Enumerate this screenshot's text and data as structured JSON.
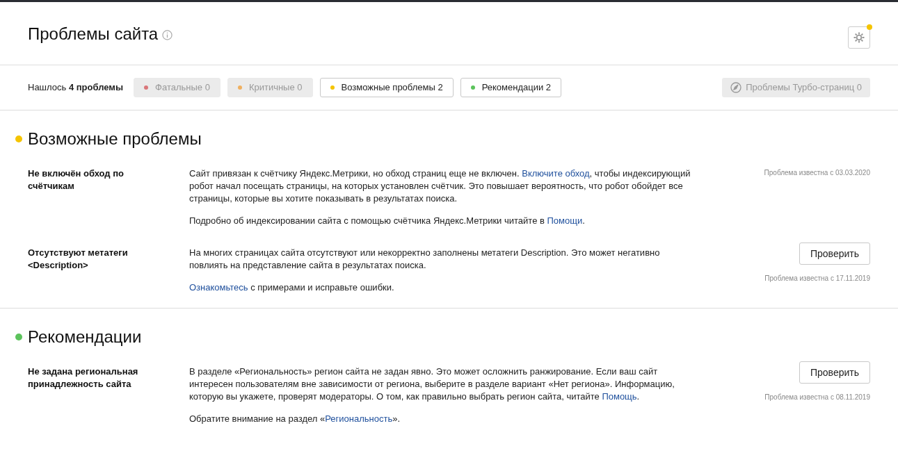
{
  "header": {
    "title": "Проблемы сайта",
    "settings_badge": true
  },
  "summary": "Нашлось **4 проблемы**",
  "filters": [
    {
      "label": "Фатальные 0",
      "color": "#d9777a",
      "disabled": true
    },
    {
      "label": "Критичные 0",
      "color": "#f0b060",
      "disabled": true
    },
    {
      "label": "Возможные проблемы 2",
      "color": "#f5c400",
      "disabled": false
    },
    {
      "label": "Рекомендации 2",
      "color": "#5cc35c",
      "disabled": false
    }
  ],
  "turbo": {
    "label": "Проблемы Турбо-страниц 0",
    "disabled": true
  },
  "sections": [
    {
      "title": "Возможные проблемы",
      "color": "#f5c400",
      "issues": [
        {
          "title": "Не включён обход по счётчикам",
          "date": "Проблема известна с 03.03.2020",
          "paragraphs": [
            [
              {
                "kind": "text",
                "text": "Сайт привязан к счётчику Яндекс.Метрики, но обход страниц еще не включен. "
              },
              {
                "kind": "link",
                "text": "Включите обход"
              },
              {
                "kind": "text",
                "text": ", чтобы индексирующий робот начал посещать страницы, на которых установлен счётчик. Это повышает вероятность, что робот обойдет все страницы, которые вы хотите показывать в результатах поиска."
              }
            ],
            [
              {
                "kind": "text",
                "text": "Подробно об индексировании сайта с помощью счётчика Яндекс.Метрики читайте в "
              },
              {
                "kind": "link",
                "text": "Помощи"
              },
              {
                "kind": "text",
                "text": "."
              }
            ]
          ]
        },
        {
          "title": "Отсутствуют метатеги <Description>",
          "button": "Проверить",
          "date": "Проблема известна с 17.11.2019",
          "paragraphs": [
            [
              {
                "kind": "text",
                "text": "На многих страницах сайта отсутствуют или некорректно заполнены метатеги Description. Это может негативно повлиять на представление сайта в результатах поиска."
              }
            ],
            [
              {
                "kind": "link",
                "text": "Ознакомьтесь"
              },
              {
                "kind": "text",
                "text": " с примерами и исправьте ошибки."
              }
            ]
          ]
        }
      ]
    },
    {
      "title": "Рекомендации",
      "color": "#5cc35c",
      "issues": [
        {
          "title": "Не задана региональная принадлежность сайта",
          "button": "Проверить",
          "date": "Проблема известна с 08.11.2019",
          "paragraphs": [
            [
              {
                "kind": "text",
                "text": "В разделе «Региональность» регион сайта не задан явно. Это может осложнить ранжирование. Если ваш сайт интересен пользователям вне зависимости от региона, выберите в разделе вариант «Нет региона». Информацию, которую вы укажете, проверят модераторы. О том, как правильно выбрать регион сайта, читайте "
              },
              {
                "kind": "link",
                "text": "Помощь"
              },
              {
                "kind": "text",
                "text": "."
              }
            ],
            [
              {
                "kind": "text",
                "text": "Обратите внимание на раздел «"
              },
              {
                "kind": "link",
                "text": "Региональность"
              },
              {
                "kind": "text",
                "text": "»."
              }
            ]
          ]
        }
      ]
    }
  ]
}
